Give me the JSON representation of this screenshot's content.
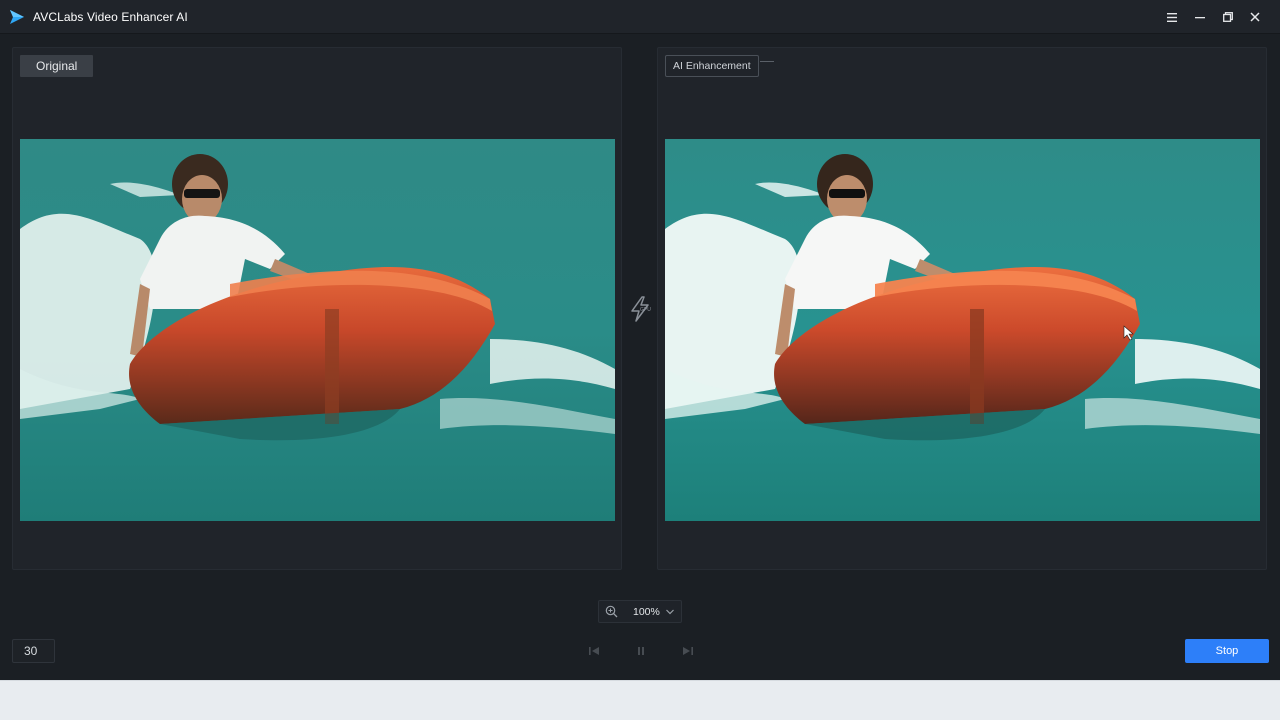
{
  "window": {
    "title": "AVCLabs Video Enhancer AI",
    "controls": [
      "menu-icon",
      "minimize-icon",
      "restore-icon",
      "close-icon"
    ]
  },
  "preview": {
    "original_label": "Original",
    "enhanced_label": "AI Enhancement",
    "divider_icon": "gpu-icon"
  },
  "zoom": {
    "value": "100%"
  },
  "footer": {
    "frame_value": "30",
    "stop_label": "Stop"
  },
  "colors": {
    "accent": "#2d7ff9",
    "background": "#1b1f24",
    "panel": "#20242a"
  }
}
